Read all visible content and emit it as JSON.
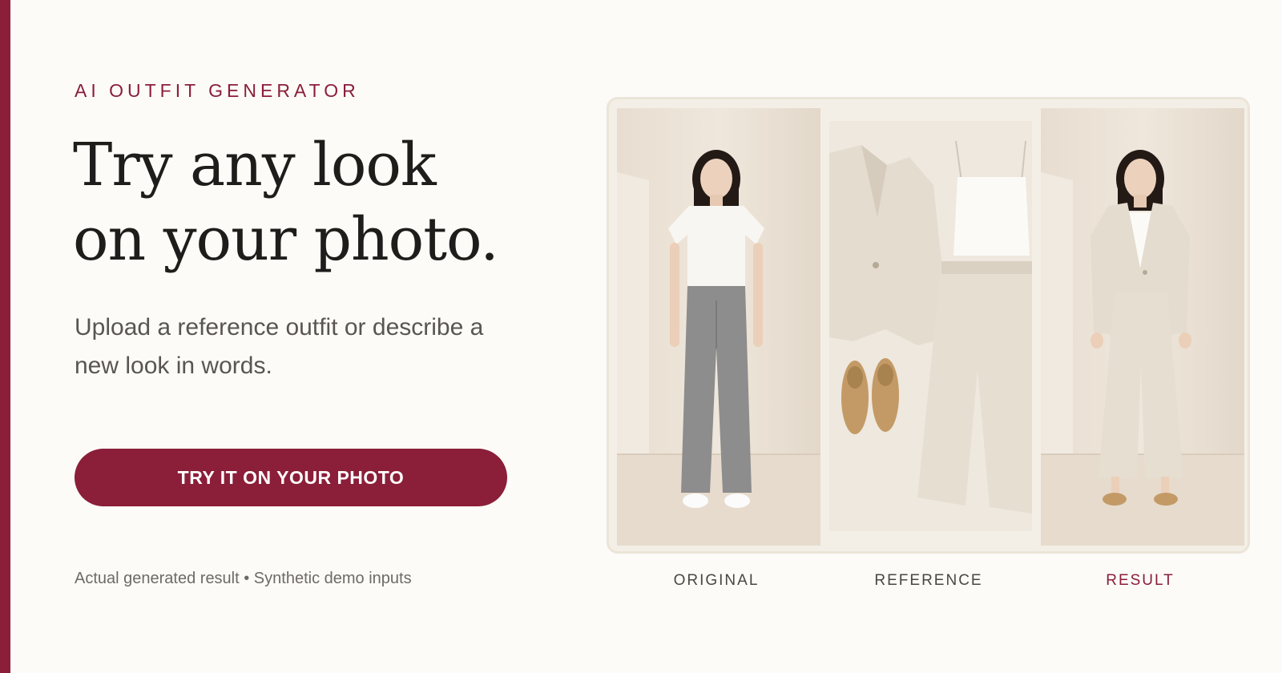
{
  "hero": {
    "eyebrow": "AI OUTFIT GENERATOR",
    "headline_line1": "Try any look",
    "headline_line2": "on your photo.",
    "subhead": "Upload a reference outfit or describe a new look in words.",
    "cta_label": "TRY IT ON YOUR PHOTO",
    "footnote": "Actual generated result • Synthetic demo inputs"
  },
  "comparison": {
    "captions": {
      "original": "ORIGINAL",
      "reference": "REFERENCE",
      "result": "RESULT"
    }
  },
  "colors": {
    "accent": "#8b1e38",
    "background": "#fcfbf8",
    "headline": "#1f1d1b",
    "body_text": "#5a5552"
  }
}
